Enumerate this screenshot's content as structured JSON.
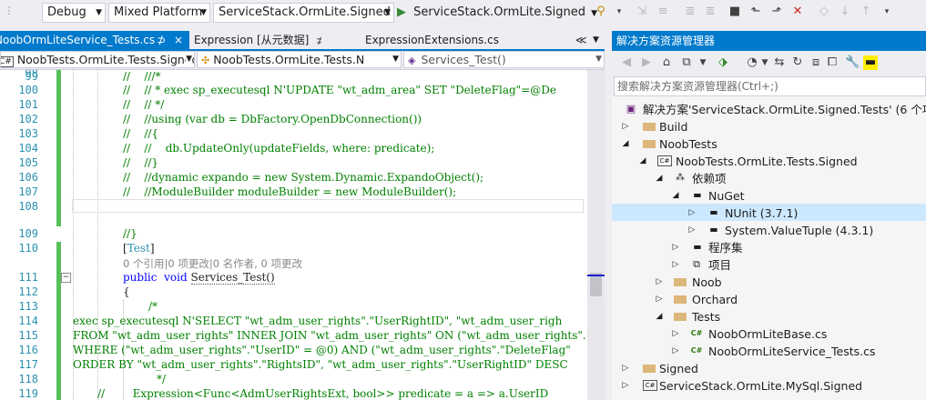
{
  "toolbar": {
    "config": "Debug",
    "platform": "Mixed Platform",
    "project": "ServiceStack.OrmLite.Signed",
    "run_label": "ServiceStack.OrmLite.Signed",
    "run_icon": "play-icon"
  },
  "tabs": [
    {
      "label": "NoobOrmLiteService_Tests.cs",
      "active": true
    },
    {
      "label": "Expression [从元数据]",
      "active": false
    },
    {
      "label": "ExpressionExtensions.cs",
      "active": false
    }
  ],
  "tab_pin": "⊅",
  "tab_close": "×",
  "tab_overflow": "≪",
  "navbar": {
    "project": "NoobTests.OrmLite.Tests.Signed",
    "class": "NoobTests.OrmLite.Tests.N",
    "member": "Services_Test()"
  },
  "code_lines": [
    {
      "n": "98",
      "t": ""
    },
    {
      "n": "99",
      "t": "//    ///*"
    },
    {
      "n": "100",
      "t": "//    // * exec sp_executesql N'UPDATE \"wt_adm_area\" SET \"DeleteFlag\"=@De"
    },
    {
      "n": "101",
      "t": "//    // */"
    },
    {
      "n": "102",
      "t": "//    //using (var db = DbFactory.OpenDbConnection())"
    },
    {
      "n": "103",
      "t": "//    //{"
    },
    {
      "n": "104",
      "t": "//    //    db.UpdateOnly(updateFields, where: predicate);"
    },
    {
      "n": "105",
      "t": "//    //}"
    },
    {
      "n": "106",
      "t": "//    //dynamic expando = new System.Dynamic.ExpandoObject();"
    },
    {
      "n": "107",
      "t": "//    //ModuleBuilder moduleBuilder = new ModuleBuilder();"
    },
    {
      "n": "108",
      "t": ""
    },
    {
      "n": "109",
      "t": "//}"
    },
    {
      "n": "110",
      "t": "[Test]"
    },
    {
      "n": "",
      "t": "0 个引用|0 项更改|0 名作者, 0 项更改"
    },
    {
      "n": "111",
      "t": "public  void Services_Test()"
    },
    {
      "n": "112",
      "t": "{"
    },
    {
      "n": "113",
      "t": "/*"
    },
    {
      "n": "114",
      "t": "exec sp_executesql N'SELECT \"wt_adm_user_rights\".\"UserRightID\", \"wt_adm_user_righ"
    },
    {
      "n": "115",
      "t": "FROM \"wt_adm_user_rights\" INNER JOIN \"wt_adm_user_rights\" ON (\"wt_adm_user_rights\".\"R"
    },
    {
      "n": "116",
      "t": "WHERE (\"wt_adm_user_rights\".\"UserID\" = @0) AND (\"wt_adm_user_rights\".\"DeleteFlag\""
    },
    {
      "n": "117",
      "t": "ORDER BY \"wt_adm_user_rights\".\"RightsID\", \"wt_adm_user_rights\".\"UserRightID\" DESC"
    },
    {
      "n": "118",
      "t": "*/"
    },
    {
      "n": "119",
      "t": "//        Expression<Func<AdmUserRightsExt, bool>> predicate = a => a.UserID"
    }
  ],
  "solution_explorer": {
    "title": "解决方案资源管理器",
    "search_placeholder": "搜索解决方案资源管理器(Ctrl+;)",
    "tree": [
      {
        "label": "解决方案'ServiceStack.OrmLite.Signed.Tests' (6 个项目)",
        "icon": "solution-icon",
        "expander": ""
      },
      {
        "label": "Build",
        "icon": "folder-icon",
        "expander": "▷"
      },
      {
        "label": "NoobTests",
        "icon": "folder-icon",
        "expander": "◢"
      },
      {
        "label": "NoobTests.OrmLite.Tests.Signed",
        "icon": "csproj-icon",
        "expander": "◢"
      },
      {
        "label": "依赖项",
        "icon": "dependencies-icon",
        "expander": "◢"
      },
      {
        "label": "NuGet",
        "icon": "package-icon",
        "expander": "◢"
      },
      {
        "label": "NUnit (3.7.1)",
        "icon": "package-icon",
        "expander": "▷"
      },
      {
        "label": "System.ValueTuple (4.3.1)",
        "icon": "package-icon",
        "expander": "▷"
      },
      {
        "label": "程序集",
        "icon": "package-icon",
        "expander": "▷"
      },
      {
        "label": "项目",
        "icon": "project-ref-icon",
        "expander": "▷"
      },
      {
        "label": "Noob",
        "icon": "folder-icon",
        "expander": "▷"
      },
      {
        "label": "Orchard",
        "icon": "folder-icon",
        "expander": "▷"
      },
      {
        "label": "Tests",
        "icon": "folder-icon",
        "expander": "◢"
      },
      {
        "label": "NoobOrmLiteBase.cs",
        "icon": "csharp-file-icon",
        "expander": "▷"
      },
      {
        "label": "NoobOrmLiteService_Tests.cs",
        "icon": "csharp-file-icon",
        "expander": "▷"
      },
      {
        "label": "Signed",
        "icon": "folder-icon",
        "expander": "▷"
      },
      {
        "label": "ServiceStack.OrmLite.MySql.Signed",
        "icon": "csproj-icon",
        "expander": "▷"
      }
    ]
  },
  "colors": {
    "accent": "#007acc",
    "selection": "#cce8ff",
    "comment": "#008000",
    "keyword": "#0000ff"
  }
}
